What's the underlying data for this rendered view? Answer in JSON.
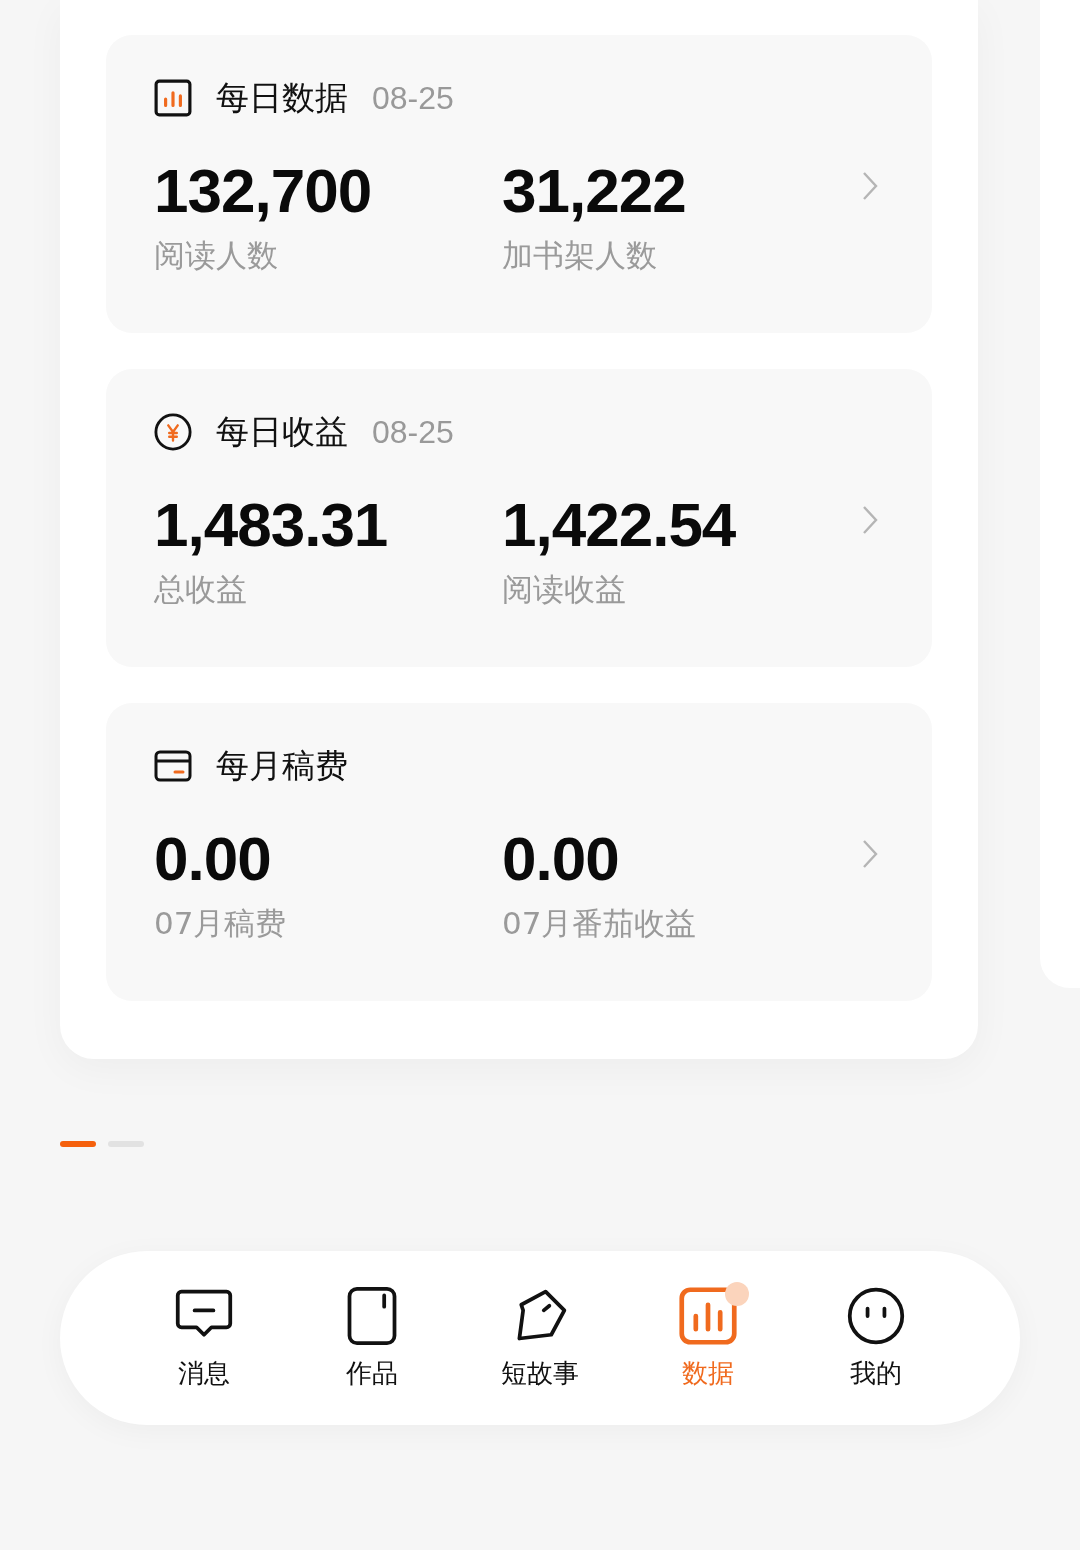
{
  "cards": [
    {
      "kind": "chart",
      "title": "每日数据",
      "date": "08-25",
      "stats": [
        {
          "value": "132,700",
          "label": "阅读人数"
        },
        {
          "value": "31,222",
          "label": "加书架人数"
        }
      ]
    },
    {
      "kind": "yen",
      "title": "每日收益",
      "date": "08-25",
      "stats": [
        {
          "value": "1,483.31",
          "label": "总收益"
        },
        {
          "value": "1,422.54",
          "label": "阅读收益"
        }
      ]
    },
    {
      "kind": "wallet",
      "title": "每月稿费",
      "stats": [
        {
          "value": "0.00",
          "label": "07月稿费"
        },
        {
          "value": "0.00",
          "label": "07月番茄收益"
        }
      ]
    }
  ],
  "pager": [
    {
      "selected": true
    },
    {
      "selected": false
    }
  ],
  "nav": [
    {
      "kind": "message",
      "label": "消息",
      "selected": false,
      "badge": false
    },
    {
      "kind": "book",
      "label": "作品",
      "selected": false,
      "badge": false
    },
    {
      "kind": "pen",
      "label": "短故事",
      "selected": false,
      "badge": false
    },
    {
      "kind": "chart",
      "label": "数据",
      "selected": true,
      "badge": true
    },
    {
      "kind": "face",
      "label": "我的",
      "selected": false,
      "badge": false
    }
  ]
}
